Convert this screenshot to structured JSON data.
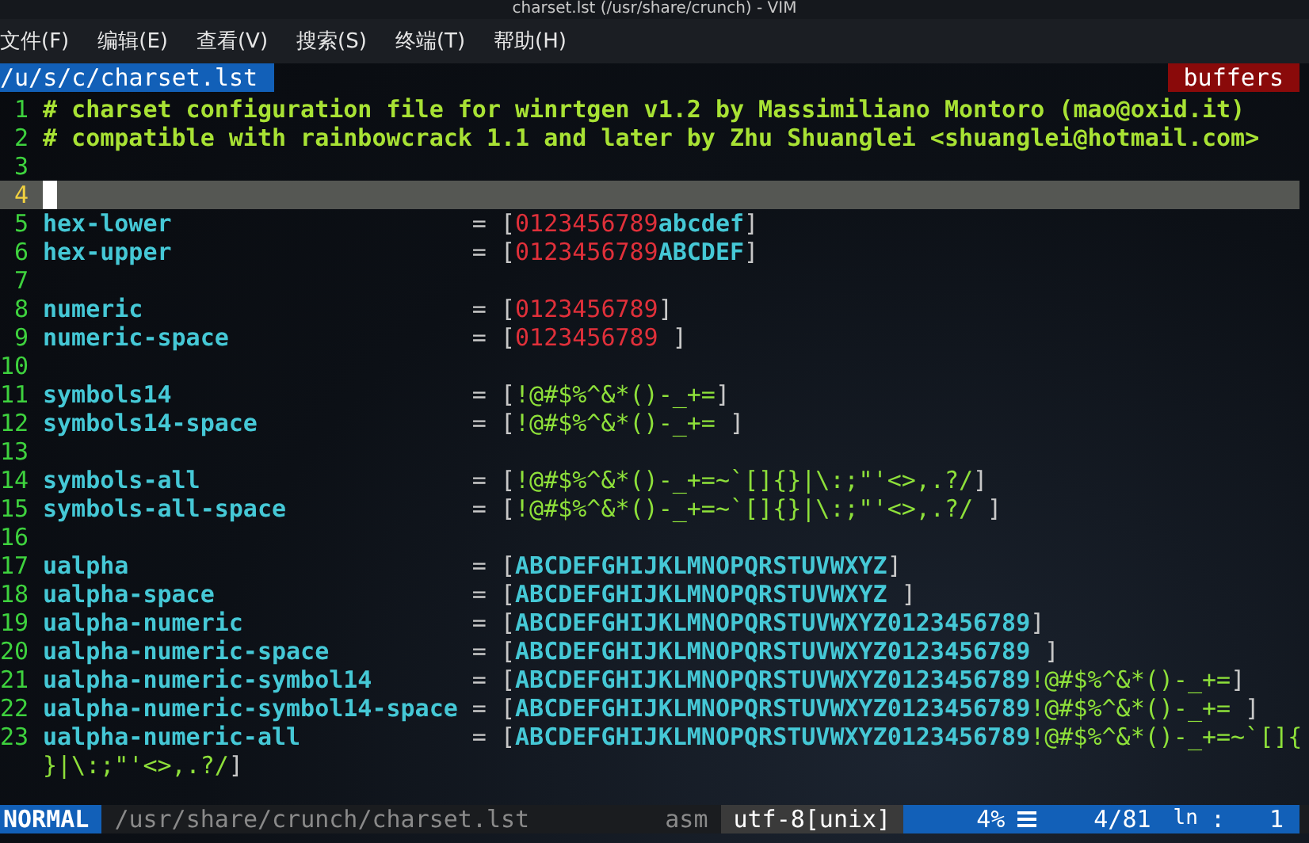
{
  "window": {
    "title": "charset.lst (/usr/share/crunch) - VIM"
  },
  "menu": [
    "文件(F)",
    "编辑(E)",
    "查看(V)",
    "搜索(S)",
    "终端(T)",
    "帮助(H)"
  ],
  "tabline": {
    "tab": {
      "label": "/u/s/c/charset.lst",
      "selected": true
    },
    "buffers": "buffers"
  },
  "lines": [
    {
      "number": "1",
      "current": false,
      "segments": [
        {
          "kind": "comment",
          "text": "# charset configuration file for winrtgen v1.2 by Massimiliano Montoro (mao@oxid.it)"
        }
      ]
    },
    {
      "number": "2",
      "current": false,
      "segments": [
        {
          "kind": "comment",
          "text": "# compatible with rainbowcrack 1.1 and later by Zhu Shuanglei <shuanglei@hotmail.com>"
        }
      ]
    },
    {
      "number": "3",
      "current": false
    },
    {
      "number": "4",
      "current": true
    },
    {
      "number": "5",
      "current": false,
      "segments": [
        {
          "kind": "key",
          "text": "hex-lower"
        },
        {
          "kind": "punct",
          "text": "= ["
        },
        {
          "kind": "digits",
          "text": "0123456789"
        },
        {
          "kind": "letters",
          "text": "abcdef"
        },
        {
          "kind": "punct",
          "text": "]"
        }
      ]
    },
    {
      "number": "6",
      "current": false,
      "segments": [
        {
          "kind": "key",
          "text": "hex-upper"
        },
        {
          "kind": "punct",
          "text": "= ["
        },
        {
          "kind": "digits",
          "text": "0123456789"
        },
        {
          "kind": "letters",
          "text": "ABCDEF"
        },
        {
          "kind": "punct",
          "text": "]"
        }
      ]
    },
    {
      "number": "7",
      "current": false
    },
    {
      "number": "8",
      "current": false,
      "segments": [
        {
          "kind": "key",
          "text": "numeric"
        },
        {
          "kind": "punct",
          "text": "= ["
        },
        {
          "kind": "digits",
          "text": "0123456789"
        },
        {
          "kind": "punct",
          "text": "]"
        }
      ]
    },
    {
      "number": "9",
      "current": false,
      "segments": [
        {
          "kind": "key",
          "text": "numeric-space"
        },
        {
          "kind": "punct",
          "text": "= ["
        },
        {
          "kind": "digits",
          "text": "0123456789"
        },
        {
          "kind": "punct",
          "text": " ]"
        }
      ]
    },
    {
      "number": "10",
      "current": false
    },
    {
      "number": "11",
      "current": false,
      "segments": [
        {
          "kind": "key",
          "text": "symbols14"
        },
        {
          "kind": "punct",
          "text": "= ["
        },
        {
          "kind": "symbols",
          "text": "!@#$%^&*()-_+="
        },
        {
          "kind": "punct",
          "text": "]"
        }
      ]
    },
    {
      "number": "12",
      "current": false,
      "segments": [
        {
          "kind": "key",
          "text": "symbols14-space"
        },
        {
          "kind": "punct",
          "text": "= ["
        },
        {
          "kind": "symbols",
          "text": "!@#$%^&*()-_+="
        },
        {
          "kind": "punct",
          "text": " ]"
        }
      ]
    },
    {
      "number": "13",
      "current": false
    },
    {
      "number": "14",
      "current": false,
      "segments": [
        {
          "kind": "key",
          "text": "symbols-all"
        },
        {
          "kind": "punct",
          "text": "= ["
        },
        {
          "kind": "symbols",
          "text": "!@#$%^&*()-_+=~`[]{}|\\:;\"'<>,.?/"
        },
        {
          "kind": "punct",
          "text": "]"
        }
      ]
    },
    {
      "number": "15",
      "current": false,
      "segments": [
        {
          "kind": "key",
          "text": "symbols-all-space"
        },
        {
          "kind": "punct",
          "text": "= ["
        },
        {
          "kind": "symbols",
          "text": "!@#$%^&*()-_+=~`[]{}|\\:;\"'<>,.?/"
        },
        {
          "kind": "punct",
          "text": " ]"
        }
      ]
    },
    {
      "number": "16",
      "current": false
    },
    {
      "number": "17",
      "current": false,
      "segments": [
        {
          "kind": "key",
          "text": "ualpha"
        },
        {
          "kind": "punct",
          "text": "= ["
        },
        {
          "kind": "letters",
          "text": "ABCDEFGHIJKLMNOPQRSTUVWXYZ"
        },
        {
          "kind": "punct",
          "text": "]"
        }
      ]
    },
    {
      "number": "18",
      "current": false,
      "segments": [
        {
          "kind": "key",
          "text": "ualpha-space"
        },
        {
          "kind": "punct",
          "text": "= ["
        },
        {
          "kind": "letters",
          "text": "ABCDEFGHIJKLMNOPQRSTUVWXYZ"
        },
        {
          "kind": "punct",
          "text": " ]"
        }
      ]
    },
    {
      "number": "19",
      "current": false,
      "segments": [
        {
          "kind": "key",
          "text": "ualpha-numeric"
        },
        {
          "kind": "punct",
          "text": "= ["
        },
        {
          "kind": "letters",
          "text": "ABCDEFGHIJKLMNOPQRSTUVWXYZ0123456789"
        },
        {
          "kind": "punct",
          "text": "]"
        }
      ]
    },
    {
      "number": "20",
      "current": false,
      "segments": [
        {
          "kind": "key",
          "text": "ualpha-numeric-space"
        },
        {
          "kind": "punct",
          "text": "= ["
        },
        {
          "kind": "letters",
          "text": "ABCDEFGHIJKLMNOPQRSTUVWXYZ0123456789"
        },
        {
          "kind": "punct",
          "text": " ]"
        }
      ]
    },
    {
      "number": "21",
      "current": false,
      "segments": [
        {
          "kind": "key",
          "text": "ualpha-numeric-symbol14"
        },
        {
          "kind": "punct",
          "text": "= ["
        },
        {
          "kind": "letters",
          "text": "ABCDEFGHIJKLMNOPQRSTUVWXYZ0123456789"
        },
        {
          "kind": "symbols",
          "text": "!@#$%^&*()-_+="
        },
        {
          "kind": "punct",
          "text": "]"
        }
      ]
    },
    {
      "number": "22",
      "current": false,
      "segments": [
        {
          "kind": "key",
          "text": "ualpha-numeric-symbol14-space"
        },
        {
          "kind": "punct",
          "text": "= ["
        },
        {
          "kind": "letters",
          "text": "ABCDEFGHIJKLMNOPQRSTUVWXYZ0123456789"
        },
        {
          "kind": "symbols",
          "text": "!@#$%^&*()-_+="
        },
        {
          "kind": "punct",
          "text": " ]"
        }
      ]
    },
    {
      "number": "23",
      "current": false,
      "segments": [
        {
          "kind": "key",
          "text": "ualpha-numeric-all"
        },
        {
          "kind": "punct",
          "text": "= ["
        },
        {
          "kind": "letters",
          "text": "ABCDEFGHIJKLMNOPQRSTUVWXYZ0123456789"
        },
        {
          "kind": "symbols",
          "text": "!@#$%^&*()-_+=~`[]{"
        }
      ]
    },
    {
      "segments": [
        {
          "kind": "symbols",
          "text": "}|\\:;\"'<>,.?/"
        },
        {
          "kind": "punct",
          "text": "]"
        }
      ]
    }
  ],
  "status_bar": {
    "mode": "NORMAL",
    "path": "/usr/share/crunch/charset.lst",
    "filetype": "asm",
    "encoding": "utf-8[unix]",
    "percent": "4%",
    "position": "4/81",
    "ln": "ln",
    "colon": ":",
    "column": "1"
  }
}
